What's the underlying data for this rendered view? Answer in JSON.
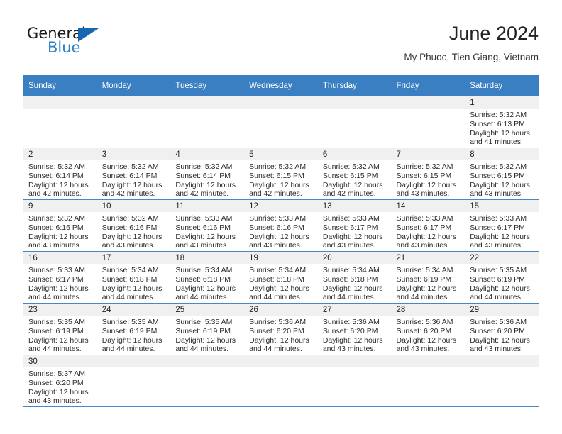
{
  "brand": {
    "name_top": "General",
    "name_bottom": "Blue",
    "triangle_color": "#1567b0",
    "blue_color": "#2980c4"
  },
  "header": {
    "title": "June 2024",
    "subtitle": "My Phuoc, Tien Giang, Vietnam"
  },
  "theme": {
    "header_row_bg": "#3a7fc1",
    "grid_line": "#4a86c5",
    "daynum_bg": "#f0f0f0"
  },
  "weekdays": [
    "Sunday",
    "Monday",
    "Tuesday",
    "Wednesday",
    "Thursday",
    "Friday",
    "Saturday"
  ],
  "weeks": [
    [
      {
        "day": "",
        "sunrise": "",
        "sunset": "",
        "daylight1": "",
        "daylight2": ""
      },
      {
        "day": "",
        "sunrise": "",
        "sunset": "",
        "daylight1": "",
        "daylight2": ""
      },
      {
        "day": "",
        "sunrise": "",
        "sunset": "",
        "daylight1": "",
        "daylight2": ""
      },
      {
        "day": "",
        "sunrise": "",
        "sunset": "",
        "daylight1": "",
        "daylight2": ""
      },
      {
        "day": "",
        "sunrise": "",
        "sunset": "",
        "daylight1": "",
        "daylight2": ""
      },
      {
        "day": "",
        "sunrise": "",
        "sunset": "",
        "daylight1": "",
        "daylight2": ""
      },
      {
        "day": "1",
        "sunrise": "Sunrise: 5:32 AM",
        "sunset": "Sunset: 6:13 PM",
        "daylight1": "Daylight: 12 hours",
        "daylight2": "and 41 minutes."
      }
    ],
    [
      {
        "day": "2",
        "sunrise": "Sunrise: 5:32 AM",
        "sunset": "Sunset: 6:14 PM",
        "daylight1": "Daylight: 12 hours",
        "daylight2": "and 42 minutes."
      },
      {
        "day": "3",
        "sunrise": "Sunrise: 5:32 AM",
        "sunset": "Sunset: 6:14 PM",
        "daylight1": "Daylight: 12 hours",
        "daylight2": "and 42 minutes."
      },
      {
        "day": "4",
        "sunrise": "Sunrise: 5:32 AM",
        "sunset": "Sunset: 6:14 PM",
        "daylight1": "Daylight: 12 hours",
        "daylight2": "and 42 minutes."
      },
      {
        "day": "5",
        "sunrise": "Sunrise: 5:32 AM",
        "sunset": "Sunset: 6:15 PM",
        "daylight1": "Daylight: 12 hours",
        "daylight2": "and 42 minutes."
      },
      {
        "day": "6",
        "sunrise": "Sunrise: 5:32 AM",
        "sunset": "Sunset: 6:15 PM",
        "daylight1": "Daylight: 12 hours",
        "daylight2": "and 42 minutes."
      },
      {
        "day": "7",
        "sunrise": "Sunrise: 5:32 AM",
        "sunset": "Sunset: 6:15 PM",
        "daylight1": "Daylight: 12 hours",
        "daylight2": "and 43 minutes."
      },
      {
        "day": "8",
        "sunrise": "Sunrise: 5:32 AM",
        "sunset": "Sunset: 6:15 PM",
        "daylight1": "Daylight: 12 hours",
        "daylight2": "and 43 minutes."
      }
    ],
    [
      {
        "day": "9",
        "sunrise": "Sunrise: 5:32 AM",
        "sunset": "Sunset: 6:16 PM",
        "daylight1": "Daylight: 12 hours",
        "daylight2": "and 43 minutes."
      },
      {
        "day": "10",
        "sunrise": "Sunrise: 5:32 AM",
        "sunset": "Sunset: 6:16 PM",
        "daylight1": "Daylight: 12 hours",
        "daylight2": "and 43 minutes."
      },
      {
        "day": "11",
        "sunrise": "Sunrise: 5:33 AM",
        "sunset": "Sunset: 6:16 PM",
        "daylight1": "Daylight: 12 hours",
        "daylight2": "and 43 minutes."
      },
      {
        "day": "12",
        "sunrise": "Sunrise: 5:33 AM",
        "sunset": "Sunset: 6:16 PM",
        "daylight1": "Daylight: 12 hours",
        "daylight2": "and 43 minutes."
      },
      {
        "day": "13",
        "sunrise": "Sunrise: 5:33 AM",
        "sunset": "Sunset: 6:17 PM",
        "daylight1": "Daylight: 12 hours",
        "daylight2": "and 43 minutes."
      },
      {
        "day": "14",
        "sunrise": "Sunrise: 5:33 AM",
        "sunset": "Sunset: 6:17 PM",
        "daylight1": "Daylight: 12 hours",
        "daylight2": "and 43 minutes."
      },
      {
        "day": "15",
        "sunrise": "Sunrise: 5:33 AM",
        "sunset": "Sunset: 6:17 PM",
        "daylight1": "Daylight: 12 hours",
        "daylight2": "and 43 minutes."
      }
    ],
    [
      {
        "day": "16",
        "sunrise": "Sunrise: 5:33 AM",
        "sunset": "Sunset: 6:17 PM",
        "daylight1": "Daylight: 12 hours",
        "daylight2": "and 44 minutes."
      },
      {
        "day": "17",
        "sunrise": "Sunrise: 5:34 AM",
        "sunset": "Sunset: 6:18 PM",
        "daylight1": "Daylight: 12 hours",
        "daylight2": "and 44 minutes."
      },
      {
        "day": "18",
        "sunrise": "Sunrise: 5:34 AM",
        "sunset": "Sunset: 6:18 PM",
        "daylight1": "Daylight: 12 hours",
        "daylight2": "and 44 minutes."
      },
      {
        "day": "19",
        "sunrise": "Sunrise: 5:34 AM",
        "sunset": "Sunset: 6:18 PM",
        "daylight1": "Daylight: 12 hours",
        "daylight2": "and 44 minutes."
      },
      {
        "day": "20",
        "sunrise": "Sunrise: 5:34 AM",
        "sunset": "Sunset: 6:18 PM",
        "daylight1": "Daylight: 12 hours",
        "daylight2": "and 44 minutes."
      },
      {
        "day": "21",
        "sunrise": "Sunrise: 5:34 AM",
        "sunset": "Sunset: 6:19 PM",
        "daylight1": "Daylight: 12 hours",
        "daylight2": "and 44 minutes."
      },
      {
        "day": "22",
        "sunrise": "Sunrise: 5:35 AM",
        "sunset": "Sunset: 6:19 PM",
        "daylight1": "Daylight: 12 hours",
        "daylight2": "and 44 minutes."
      }
    ],
    [
      {
        "day": "23",
        "sunrise": "Sunrise: 5:35 AM",
        "sunset": "Sunset: 6:19 PM",
        "daylight1": "Daylight: 12 hours",
        "daylight2": "and 44 minutes."
      },
      {
        "day": "24",
        "sunrise": "Sunrise: 5:35 AM",
        "sunset": "Sunset: 6:19 PM",
        "daylight1": "Daylight: 12 hours",
        "daylight2": "and 44 minutes."
      },
      {
        "day": "25",
        "sunrise": "Sunrise: 5:35 AM",
        "sunset": "Sunset: 6:19 PM",
        "daylight1": "Daylight: 12 hours",
        "daylight2": "and 44 minutes."
      },
      {
        "day": "26",
        "sunrise": "Sunrise: 5:36 AM",
        "sunset": "Sunset: 6:20 PM",
        "daylight1": "Daylight: 12 hours",
        "daylight2": "and 44 minutes."
      },
      {
        "day": "27",
        "sunrise": "Sunrise: 5:36 AM",
        "sunset": "Sunset: 6:20 PM",
        "daylight1": "Daylight: 12 hours",
        "daylight2": "and 43 minutes."
      },
      {
        "day": "28",
        "sunrise": "Sunrise: 5:36 AM",
        "sunset": "Sunset: 6:20 PM",
        "daylight1": "Daylight: 12 hours",
        "daylight2": "and 43 minutes."
      },
      {
        "day": "29",
        "sunrise": "Sunrise: 5:36 AM",
        "sunset": "Sunset: 6:20 PM",
        "daylight1": "Daylight: 12 hours",
        "daylight2": "and 43 minutes."
      }
    ],
    [
      {
        "day": "30",
        "sunrise": "Sunrise: 5:37 AM",
        "sunset": "Sunset: 6:20 PM",
        "daylight1": "Daylight: 12 hours",
        "daylight2": "and 43 minutes."
      },
      {
        "day": "",
        "sunrise": "",
        "sunset": "",
        "daylight1": "",
        "daylight2": ""
      },
      {
        "day": "",
        "sunrise": "",
        "sunset": "",
        "daylight1": "",
        "daylight2": ""
      },
      {
        "day": "",
        "sunrise": "",
        "sunset": "",
        "daylight1": "",
        "daylight2": ""
      },
      {
        "day": "",
        "sunrise": "",
        "sunset": "",
        "daylight1": "",
        "daylight2": ""
      },
      {
        "day": "",
        "sunrise": "",
        "sunset": "",
        "daylight1": "",
        "daylight2": ""
      },
      {
        "day": "",
        "sunrise": "",
        "sunset": "",
        "daylight1": "",
        "daylight2": ""
      }
    ]
  ]
}
